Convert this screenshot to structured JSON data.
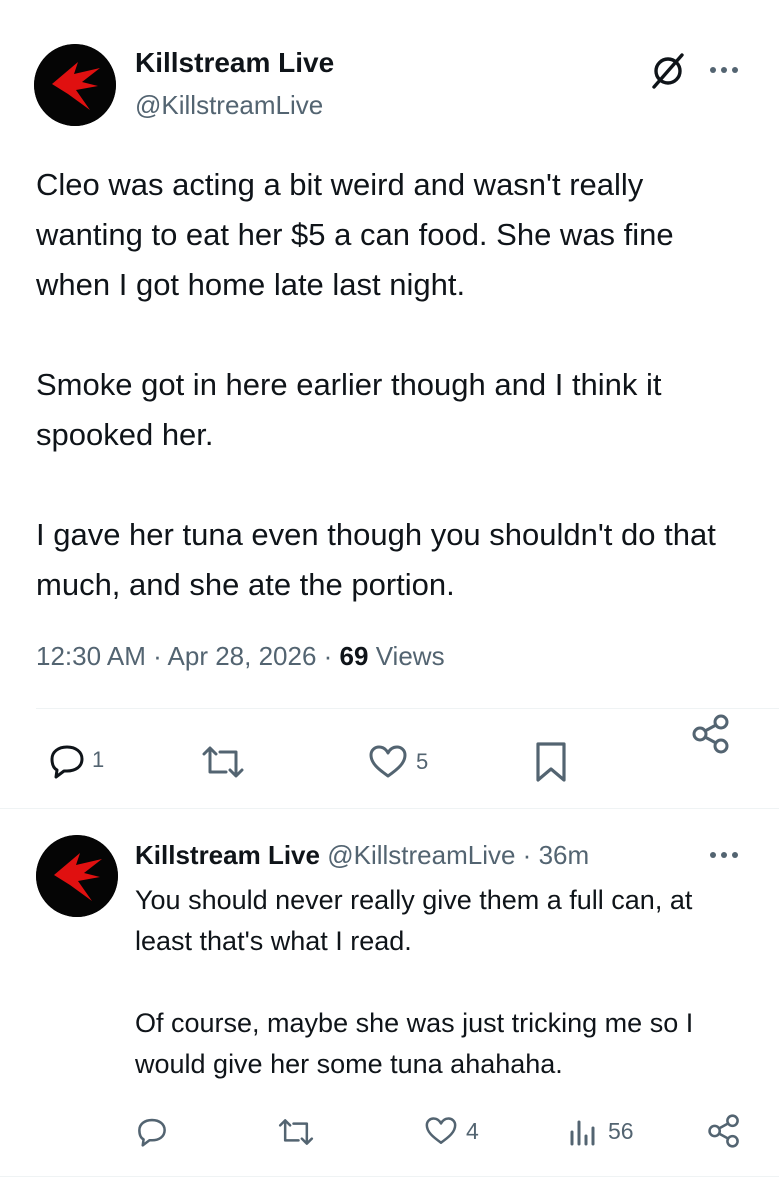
{
  "main_post": {
    "author_name": "Killstream Live",
    "author_handle": "@KillstreamLive",
    "paragraphs": [
      "Cleo was acting a bit weird and wasn't really wanting to eat her $5 a can food. She was fine when I got home late last night.",
      "Smoke got in here earlier though and I think it spooked her.",
      "I gave her tuna even though you shouldn't do that much, and she ate the portion."
    ],
    "time": "12:30 AM",
    "date": "Apr 28, 2026",
    "views_count": "69",
    "views_label": "Views",
    "replies": "1",
    "likes": "5"
  },
  "reply_post": {
    "author_name": "Killstream Live",
    "author_handle": "@KillstreamLive",
    "age": "36m",
    "paragraphs": [
      "You should never really give them a full can, at least that's what I read.",
      "Of course, maybe she was just tricking me so I would give her some tuna ahahaha."
    ],
    "likes": "4",
    "views": "56"
  },
  "icons": [
    "avatar-logo",
    "grok-icon",
    "more-icon",
    "reply-icon",
    "repost-icon",
    "like-icon",
    "bookmark-icon",
    "share-icon",
    "views-icon"
  ]
}
